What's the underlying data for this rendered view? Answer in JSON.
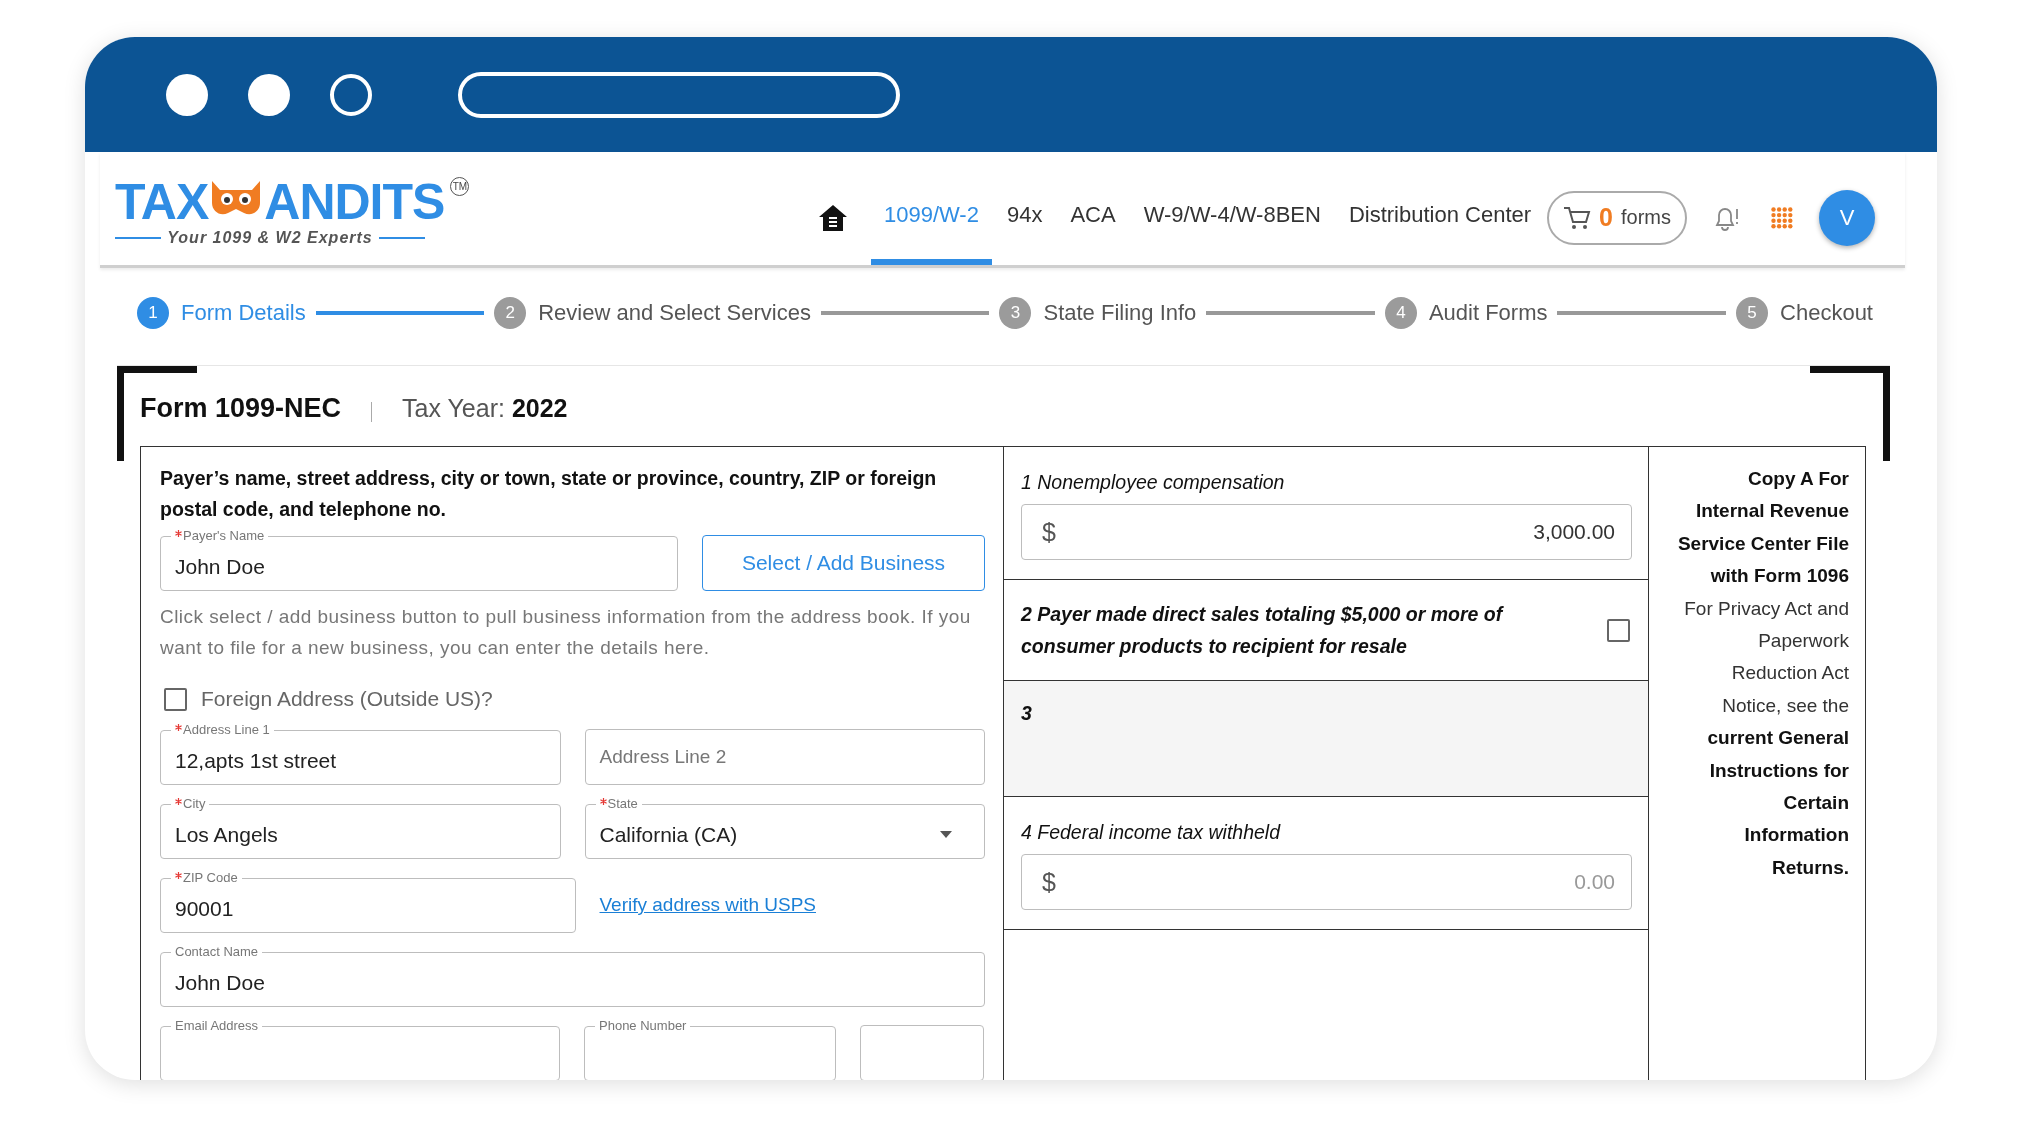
{
  "header": {
    "logo": {
      "left": "TAX",
      "right": "ANDITS",
      "tagline": "Your 1099 & W2 Experts",
      "trademark": "TM"
    },
    "nav": [
      {
        "label": "1099/W-2",
        "selected": true
      },
      {
        "label": "94x",
        "selected": false
      },
      {
        "label": "ACA",
        "selected": false
      },
      {
        "label": "W-9/W-4/W-8BEN",
        "selected": false
      },
      {
        "label": "Distribution Center",
        "selected": false
      }
    ],
    "cart": {
      "count": "0",
      "label": "forms"
    },
    "avatar": "V"
  },
  "steps": [
    {
      "number": "1",
      "label": "Form Details",
      "selected": true
    },
    {
      "number": "2",
      "label": "Review and Select Services",
      "selected": false
    },
    {
      "number": "3",
      "label": "State Filing Info",
      "selected": false
    },
    {
      "number": "4",
      "label": "Audit Forms",
      "selected": false
    },
    {
      "number": "5",
      "label": "Checkout",
      "selected": false
    }
  ],
  "form": {
    "title": "Form 1099-NEC",
    "year_label": "Tax Year:",
    "year": "2022"
  },
  "payer": {
    "heading": "Payer’s name, street address, city or town, state or province, country, ZIP or foreign postal code, and telephone no.",
    "payer_name": {
      "label": "Payer's Name",
      "required": true,
      "value": "John Doe"
    },
    "select_button": "Select / Add Business",
    "hint": "Click select / add business button to pull business information from the address book. If you want to file for a new business, you can enter the details here.",
    "foreign_address": {
      "label": "Foreign Address (Outside US)?",
      "checked": false
    },
    "address_line_1": {
      "label": "Address Line 1",
      "required": true,
      "value": "12,apts 1st street"
    },
    "address_line_2": {
      "placeholder": "Address Line 2"
    },
    "city": {
      "label": "City",
      "required": true,
      "value": "Los Angels"
    },
    "state": {
      "label": "State",
      "required": true,
      "value": "California (CA)"
    },
    "zip": {
      "label": "ZIP Code",
      "required": true,
      "value": "90001"
    },
    "verify_link": "Verify address with USPS",
    "contact_name": {
      "label": "Contact Name",
      "required": false,
      "value": "John Doe"
    },
    "email": {
      "label": "Email Address",
      "required": false
    },
    "phone": {
      "label": "Phone Number",
      "required": false
    }
  },
  "boxes": [
    {
      "kind": "amount",
      "label": "1 Nonemployee compensation",
      "currency": "$",
      "value": "3,000.00"
    },
    {
      "kind": "checkbox",
      "label": "2 Payer made direct sales totaling $5,000 or more of consumer products to recipient for resale",
      "checked": false
    },
    {
      "kind": "blank",
      "label": "3"
    },
    {
      "kind": "amount",
      "label": "4 Federal income tax withheld",
      "currency": "$",
      "placeholder": "0.00"
    }
  ],
  "copy_note": "**Copy A For Internal Revenue Service Center File with Form 1096** For Privacy Act and Paperwork Reduction Act Notice, see the **current General Instructions for Certain Information Returns.**"
}
